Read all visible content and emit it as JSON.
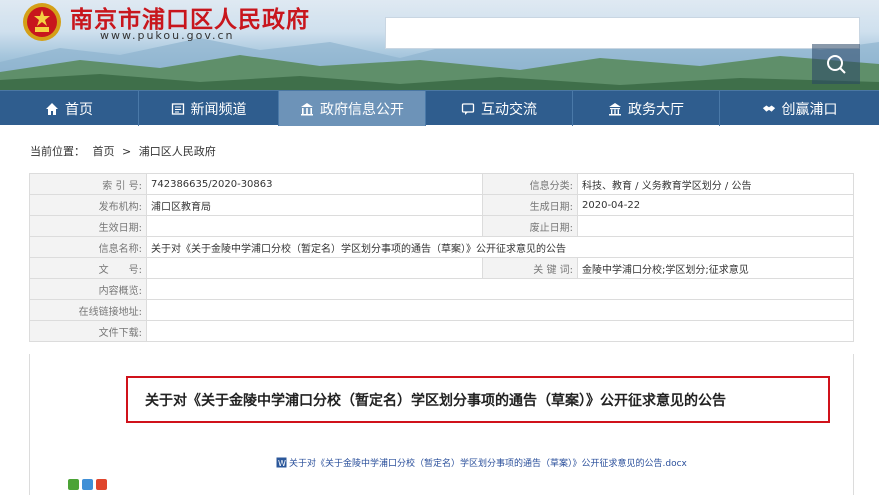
{
  "header": {
    "site_title": "南京市浦口区人民政府",
    "site_url": "www.pukou.gov.cn",
    "search": {
      "placeholder": "",
      "button_icon": "search-icon"
    }
  },
  "nav": {
    "items": [
      {
        "label": "首页",
        "icon": "home-icon",
        "active": false
      },
      {
        "label": "新闻频道",
        "icon": "news-icon",
        "active": false
      },
      {
        "label": "政府信息公开",
        "icon": "gov-info-icon",
        "active": true
      },
      {
        "label": "互动交流",
        "icon": "chat-icon",
        "active": false
      },
      {
        "label": "政务大厅",
        "icon": "hall-icon",
        "active": false
      },
      {
        "label": "创赢浦口",
        "icon": "handshake-icon",
        "active": false
      }
    ]
  },
  "breadcrumb": {
    "prefix": "当前位置：",
    "items": [
      "首页",
      ">",
      "浦口区人民政府"
    ]
  },
  "info": {
    "index_no_label": "索 引 号:",
    "index_no": "742386635/2020-30863",
    "category_label": "信息分类:",
    "category": "科技、教育 / 义务教育学区划分 / 公告",
    "publisher_label": "发布机构:",
    "publisher": "浦口区教育局",
    "generated_label": "生成日期:",
    "generated": "2020-04-22",
    "effective_label": "生效日期:",
    "effective": "",
    "expire_label": "废止日期:",
    "expire": "",
    "name_label": "信息名称:",
    "name": "关于对《关于金陵中学浦口分校（暂定名）学区划分事项的通告（草案）》公开征求意见的公告",
    "doc_no_label": "文　　号:",
    "doc_no": "",
    "keywords_label": "关 键 词:",
    "keywords": "金陵中学浦口分校;学区划分;征求意见",
    "summary_label": "内容概览:",
    "summary": "",
    "link_label": "在线链接地址:",
    "link": "",
    "download_label": "文件下载:",
    "download": ""
  },
  "content": {
    "headline": "关于对《关于金陵中学浦口分校（暂定名）学区划分事项的通告（草案）》公开征求意见的公告",
    "attachment": "关于对《关于金陵中学浦口分校（暂定名）学区划分事项的通告（草案）》公开征求意见的公告.docx"
  },
  "colors": {
    "title_red": "#c8161d",
    "nav_blue": "#2f5d8e",
    "nav_active": "#6d93b8",
    "highlight_red": "#d0121b"
  }
}
